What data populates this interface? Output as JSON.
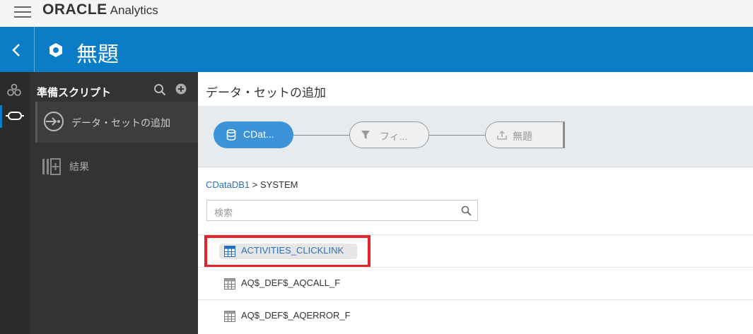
{
  "app": {
    "brand": "ORACLE",
    "product": "Analytics"
  },
  "header": {
    "back_icon": "chevron-left-icon",
    "title": "無題"
  },
  "rail": {
    "items": [
      {
        "icon": "data-connections-icon"
      },
      {
        "icon": "data-prep-icon"
      }
    ]
  },
  "panel": {
    "title": "準備スクリプト",
    "steps": [
      {
        "label": "データ・セットの追加"
      },
      {
        "label": "結果"
      }
    ]
  },
  "main": {
    "title": "データ・セットの追加",
    "flow": {
      "nodes": [
        {
          "label": "CDat..."
        },
        {
          "label": "フィ..."
        },
        {
          "label": "無題"
        }
      ]
    },
    "breadcrumb": {
      "root": "CDataDB1",
      "separator": ">",
      "current": "SYSTEM"
    },
    "search": {
      "placeholder": "検索",
      "value": ""
    },
    "tables": [
      {
        "name": "ACTIVITIES_CLICKLINK",
        "selected": true
      },
      {
        "name": "AQ$_DEF$_AQCALL_F",
        "selected": false
      },
      {
        "name": "AQ$_DEF$_AQERROR_F",
        "selected": false
      }
    ]
  },
  "colors": {
    "accent": "#0b7dc7",
    "highlight": "#e3242b",
    "rail": "#2b2b2b",
    "panel": "#333333"
  }
}
